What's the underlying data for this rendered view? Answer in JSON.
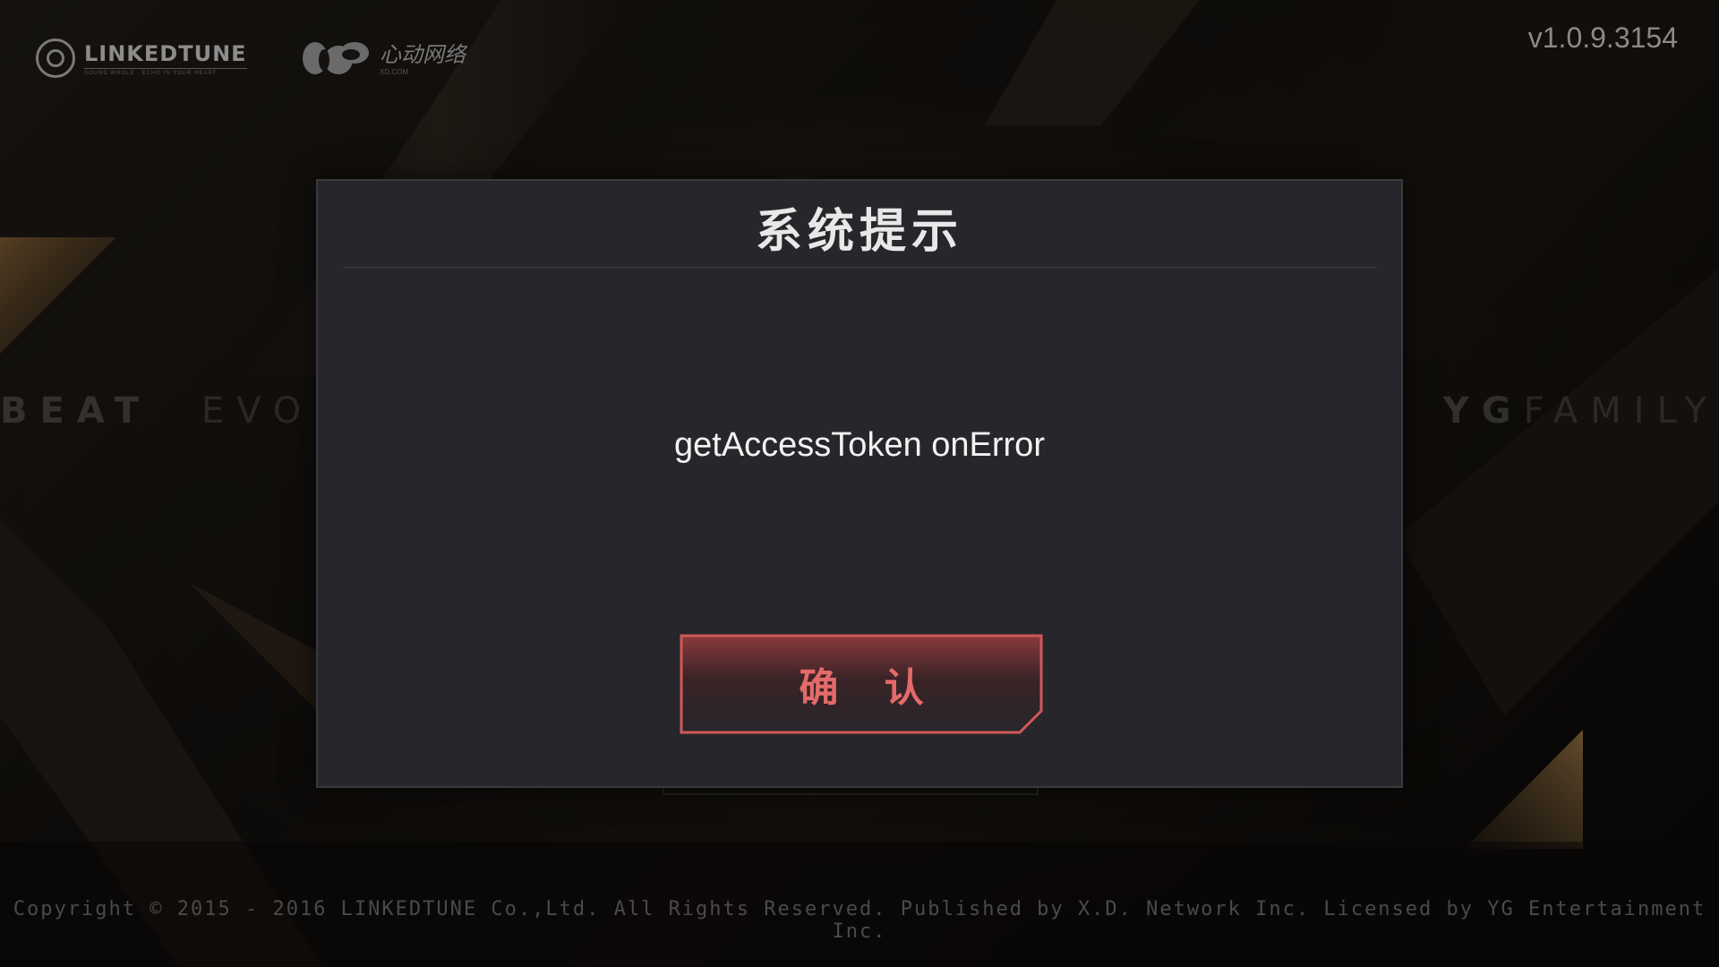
{
  "header": {
    "linkedtune_logo": {
      "name": "LINKEDTUNE",
      "tagline": "SOUND WHOLE · ECHO IN YOUR HEART",
      "icon": "linkedtune-logo-icon"
    },
    "xd_logo": {
      "name": "心动网络",
      "domain": "XD.COM",
      "icon": "xd-cloud-logo-icon"
    },
    "version": "v1.0.9.3154"
  },
  "background": {
    "left_text_bold": "BEAT",
    "left_text_thin": "EVO",
    "right_text_bold": "YG",
    "right_text_thin": "FAMILY",
    "colors": {
      "base": "#0b0a09",
      "gold_accent": "#7a5a32"
    }
  },
  "dialog": {
    "title": "系统提示",
    "message": "getAccessToken onError",
    "confirm_label": "确 认",
    "colors": {
      "panel": "#27272b",
      "button_border": "#d15858",
      "button_text": "#e46a6a"
    }
  },
  "footer": {
    "copyright": "Copyright © 2015 - 2016 LINKEDTUNE Co.,Ltd. All Rights Reserved. Published by X.D. Network Inc. Licensed by YG Entertainment Inc."
  }
}
